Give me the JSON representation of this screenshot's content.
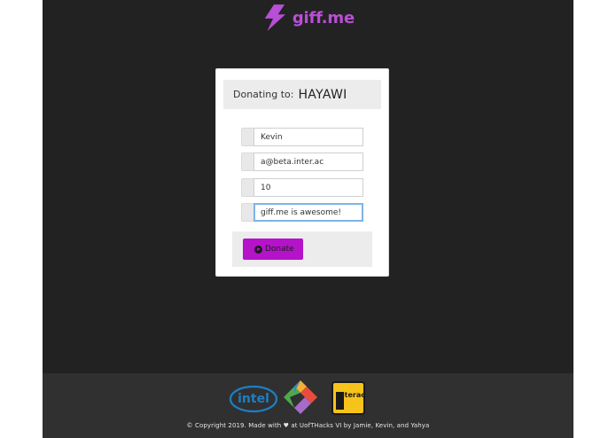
{
  "brand": {
    "name": "giff.me",
    "icon": "lightning-bolt-icon",
    "color": "#b84fd6"
  },
  "donation_card": {
    "donating_to_label": "Donating to:",
    "recipient": "HAYAWI",
    "fields": {
      "name_value": "Kevin",
      "email_value": "a@beta.inter.ac",
      "amount_value": "10",
      "message_value": "giff.me is awesome!"
    },
    "donate_button_label": "Donate",
    "accent_color": "#b413c9"
  },
  "footer": {
    "sponsors": [
      {
        "name": "intel",
        "icon": "intel-logo"
      },
      {
        "name": "",
        "icon": "multicolor-diamond-logo"
      },
      {
        "name": "Interac",
        "icon": "interac-logo"
      }
    ],
    "copyright": "© Copyright 2019. Made with ♥ at UofTHacks VI by Jamie, Kevin, and Yahya"
  }
}
